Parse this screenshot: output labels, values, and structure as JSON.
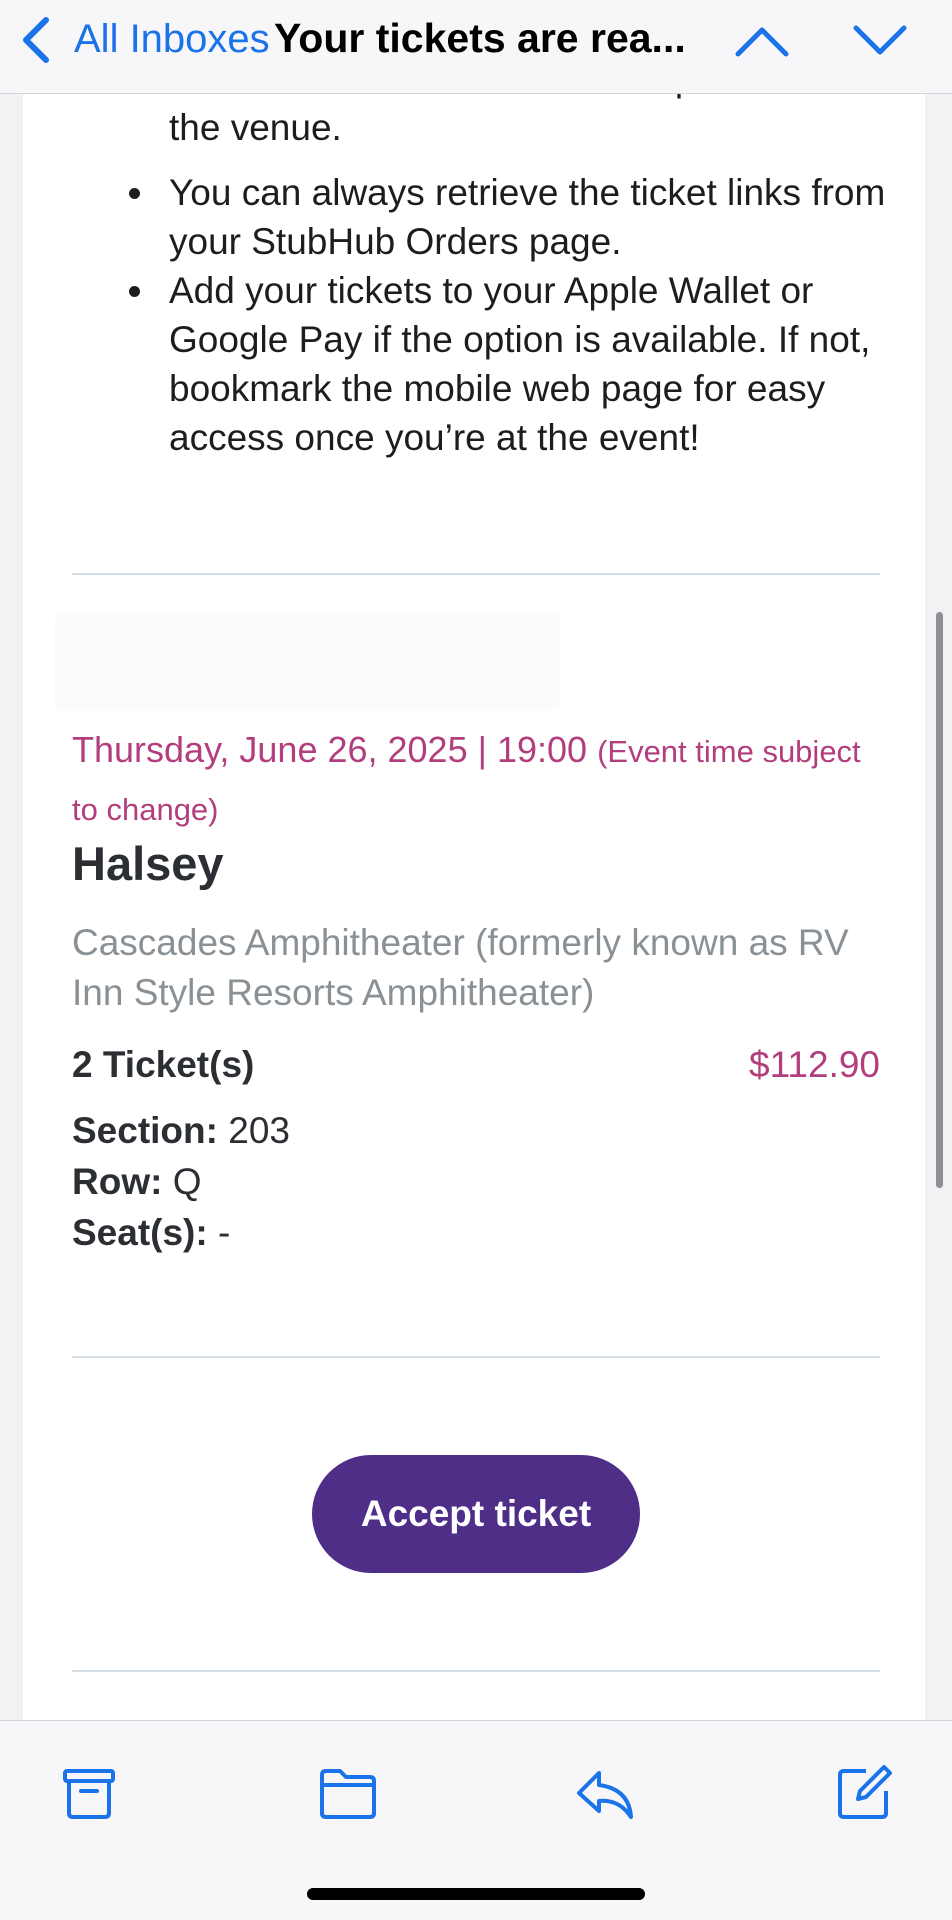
{
  "nav": {
    "back_label": "All Inboxes",
    "title": "Your tickets are rea..."
  },
  "bullets": {
    "partial_line_1": "or screenshots will not be accepted at",
    "partial_line_2": "the venue.",
    "item_2": "You can always retrieve the ticket links from your StubHub Orders page.",
    "item_3": "Add your tickets to your Apple Wallet or Google Pay if the option is available. If not, bookmark the mobile web page for easy access once you’re at the event!"
  },
  "event": {
    "date_time": "Thursday, June 26, 2025 | 19:00",
    "time_note": "(Event time subject to change)",
    "name": "Halsey",
    "venue": "Cascades Amphitheater (formerly known as RV Inn Style Resorts Amphitheater)",
    "ticket_count": "2 Ticket(s)",
    "price": "$112.90",
    "section_label": "Section:",
    "section_value": "203",
    "row_label": "Row:",
    "row_value": "Q",
    "seats_label": "Seat(s):",
    "seats_value": "-"
  },
  "actions": {
    "accept_label": "Accept ticket"
  },
  "colors": {
    "accent_blue": "#1a73e8",
    "event_magenta": "#b23e7d",
    "button_purple": "#4f2e88",
    "muted_gray": "#8a9196"
  },
  "icons": {
    "toolbar": [
      "archive-icon",
      "folder-icon",
      "reply-icon",
      "compose-icon"
    ],
    "nav": [
      "chevron-left-icon",
      "chevron-up-icon",
      "chevron-down-icon"
    ]
  }
}
